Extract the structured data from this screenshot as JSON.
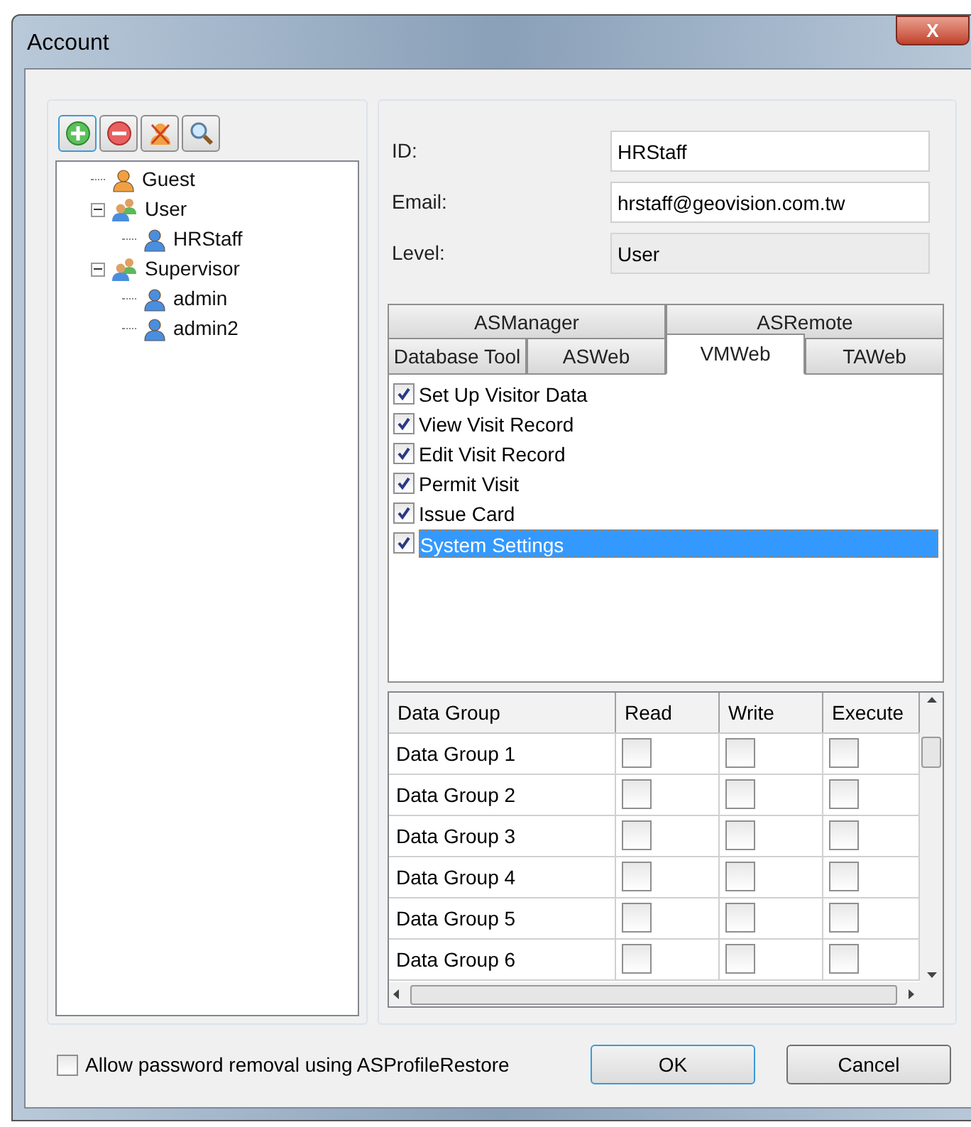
{
  "window": {
    "title": "Account",
    "close_label": "X"
  },
  "tree": [
    {
      "label": "Guest",
      "kind": "guest"
    },
    {
      "label": "User",
      "kind": "group",
      "expanded": true,
      "children": [
        {
          "label": "HRStaff",
          "kind": "user"
        }
      ]
    },
    {
      "label": "Supervisor",
      "kind": "group",
      "expanded": true,
      "children": [
        {
          "label": "admin",
          "kind": "user"
        },
        {
          "label": "admin2",
          "kind": "user"
        }
      ]
    }
  ],
  "fields": [
    {
      "label": "ID:",
      "value": "HRStaff",
      "disabled": false
    },
    {
      "label": "Email:",
      "value": "hrstaff@geovision.com.tw",
      "disabled": false
    },
    {
      "label": "Level:",
      "value": "User",
      "disabled": true
    }
  ],
  "tab_rows": [
    [
      {
        "label": "ASManager",
        "selected": false
      },
      {
        "label": "ASRemote",
        "selected": false
      }
    ],
    [
      {
        "label": "Database Tool",
        "selected": false
      },
      {
        "label": "ASWeb",
        "selected": false
      },
      {
        "label": "VMWeb",
        "selected": true
      },
      {
        "label": "TAWeb",
        "selected": false
      }
    ]
  ],
  "permissions": [
    {
      "label": "Set Up Visitor Data",
      "checked": true,
      "selected": false
    },
    {
      "label": "View Visit Record",
      "checked": true,
      "selected": false
    },
    {
      "label": "Edit Visit Record",
      "checked": true,
      "selected": false
    },
    {
      "label": "Permit Visit",
      "checked": true,
      "selected": false
    },
    {
      "label": "Issue Card",
      "checked": true,
      "selected": false
    },
    {
      "label": "System Settings",
      "checked": true,
      "selected": true
    }
  ],
  "table": {
    "columns": [
      "Data Group",
      "Read",
      "Write",
      "Execute"
    ],
    "rows": [
      {
        "name": "Data Group 1",
        "read": false,
        "write": false,
        "execute": false
      },
      {
        "name": "Data Group 2",
        "read": false,
        "write": false,
        "execute": false
      },
      {
        "name": "Data Group 3",
        "read": false,
        "write": false,
        "execute": false
      },
      {
        "name": "Data Group 4",
        "read": false,
        "write": false,
        "execute": false
      },
      {
        "name": "Data Group 5",
        "read": false,
        "write": false,
        "execute": false
      },
      {
        "name": "Data Group 6",
        "read": false,
        "write": false,
        "execute": false
      }
    ]
  },
  "allow_removal": {
    "label": "Allow password removal using ASProfileRestore",
    "checked": false
  },
  "buttons": [
    {
      "label": "OK",
      "default": true
    },
    {
      "label": "Cancel",
      "default": false
    }
  ]
}
